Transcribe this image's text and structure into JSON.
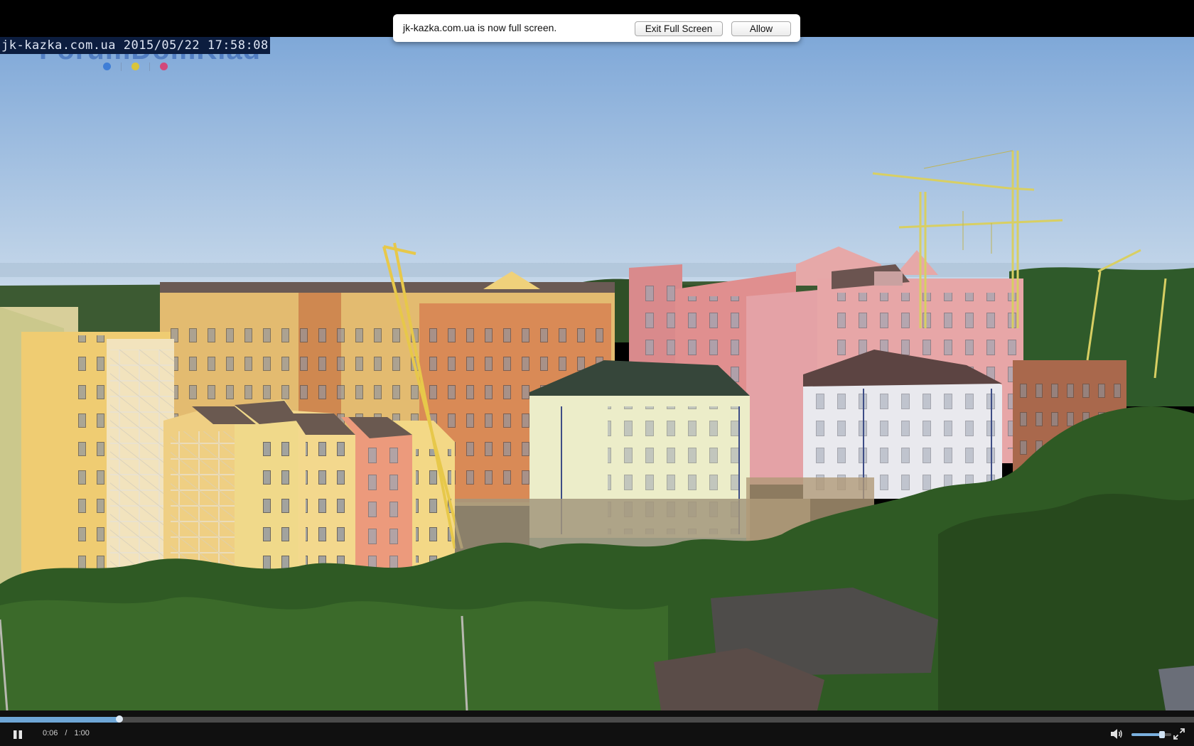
{
  "fullscreen_notice": {
    "message": "jk-kazka.com.ua is now full screen.",
    "exit_button_label": "Exit Full Screen",
    "allow_button_label": "Allow"
  },
  "video": {
    "watermark": "jk-kazka.com.ua 2015/05/22 17:58:08",
    "logo_ghost_text": "ForumDomKiad",
    "logo_dot_colors": [
      "#3f7ed6",
      "#d9c53a",
      "#d2487a"
    ]
  },
  "controls": {
    "current_time": "0:06",
    "separator": "/",
    "duration": "1:00",
    "progress_fraction": 0.1,
    "volume_fraction": 0.8,
    "play_state_icon": "pause-icon",
    "mute_icon": "speaker-icon",
    "fullscreen_icon": "fullscreen-exit-icon"
  },
  "colors": {
    "progress_fill": "#6ea6d6",
    "control_bar": "#101010"
  }
}
